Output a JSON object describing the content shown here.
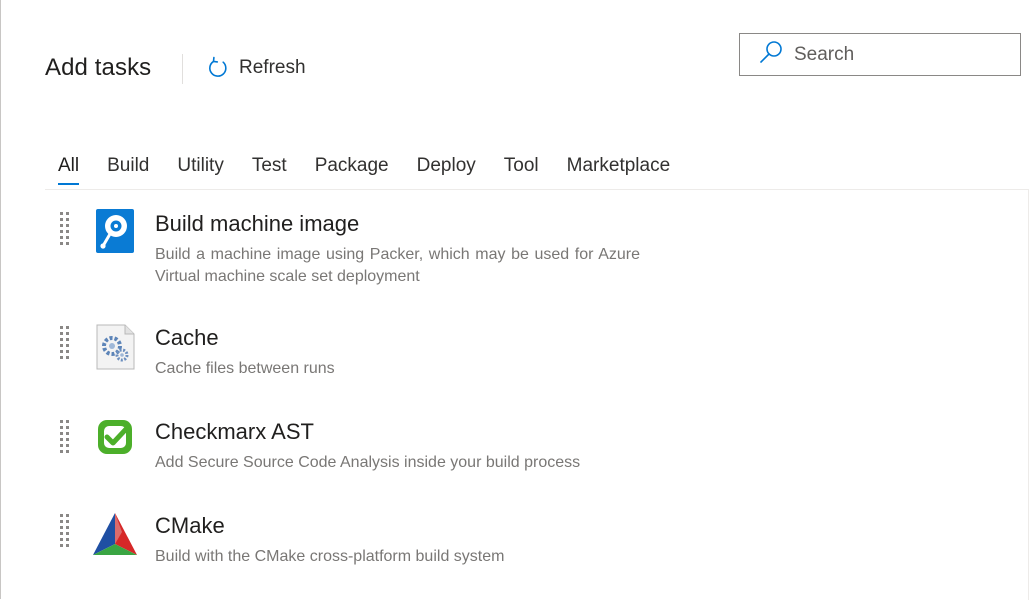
{
  "header": {
    "title": "Add tasks",
    "refresh_label": "Refresh"
  },
  "search": {
    "placeholder": "Search",
    "value": ""
  },
  "tabs": [
    {
      "label": "All",
      "active": true
    },
    {
      "label": "Build",
      "active": false
    },
    {
      "label": "Utility",
      "active": false
    },
    {
      "label": "Test",
      "active": false
    },
    {
      "label": "Package",
      "active": false
    },
    {
      "label": "Deploy",
      "active": false
    },
    {
      "label": "Tool",
      "active": false
    },
    {
      "label": "Marketplace",
      "active": false
    }
  ],
  "tasks": [
    {
      "title": "Build machine image",
      "description": "Build a machine image using Packer, which may be used for Azure Virtual machine scale set deployment",
      "icon": "packer-disk-icon"
    },
    {
      "title": "Cache",
      "description": "Cache files between runs",
      "icon": "cache-gear-icon"
    },
    {
      "title": "Checkmarx AST",
      "description": "Add Secure Source Code Analysis inside your build process",
      "icon": "checkmarx-icon"
    },
    {
      "title": "CMake",
      "description": "Build with the CMake cross-platform build system",
      "icon": "cmake-icon"
    }
  ],
  "colors": {
    "accent": "#0078d4",
    "text_primary": "#201f1e",
    "text_secondary": "#797775",
    "border": "#8a8886"
  }
}
